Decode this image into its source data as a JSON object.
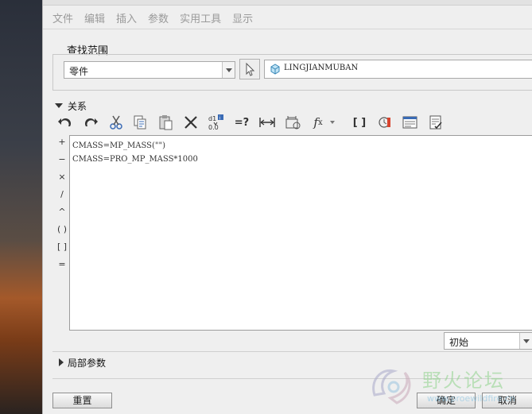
{
  "menu": [
    "文件",
    "编辑",
    "插入",
    "参数",
    "实用工具",
    "显示"
  ],
  "scope": {
    "title": "查找范围",
    "type_value": "零件",
    "model_value": "LINGJIANMUBAN"
  },
  "relations": {
    "header": "关系",
    "toolbar": [
      {
        "name": "undo-icon",
        "glyph": "↶"
      },
      {
        "name": "redo-icon",
        "glyph": "↷"
      },
      {
        "name": "cut-icon",
        "glyph": "✂"
      },
      {
        "name": "copy-icon",
        "glyph": "⧉"
      },
      {
        "name": "paste-icon",
        "glyph": "📋"
      },
      {
        "name": "delete-icon",
        "glyph": "✕"
      },
      {
        "name": "sort-relations-icon",
        "glyph": "⇅"
      },
      {
        "name": "evaluate-icon",
        "glyph": "=?"
      },
      {
        "name": "dimension-icon",
        "glyph": "↔"
      },
      {
        "name": "show-dimensions-icon",
        "glyph": "⊟"
      },
      {
        "name": "function-icon",
        "glyph": "fx"
      },
      {
        "name": "brackets-icon",
        "glyph": "[ ]"
      },
      {
        "name": "verify-icon",
        "glyph": "⚠"
      },
      {
        "name": "parameters-icon",
        "glyph": "▤"
      },
      {
        "name": "checklist-icon",
        "glyph": "☑"
      }
    ],
    "operators": [
      "+",
      "−",
      "×",
      "/",
      "^",
      "( )",
      "[ ]",
      "="
    ],
    "lines": [
      "CMASS=MP_MASS(\"\")",
      "CMASS=PRO_MP_MASS*1000"
    ],
    "status_value": "初始"
  },
  "local_params": {
    "label": "局部参数"
  },
  "buttons": {
    "reset": "重置",
    "ok": "确定",
    "cancel": "取消"
  },
  "watermark": {
    "text": "野火论坛",
    "url": "www.proewildfire.cn"
  }
}
